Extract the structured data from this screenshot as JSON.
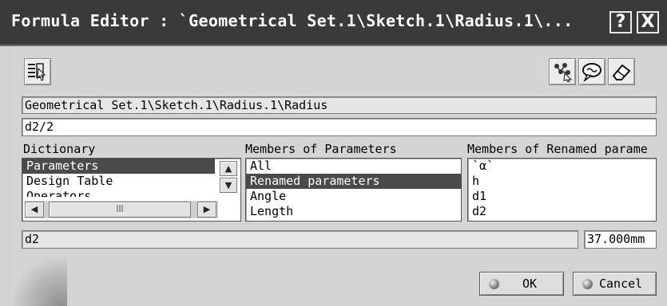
{
  "window": {
    "title": "Formula Editor : `Geometrical Set.1\\Sketch.1\\Radius.1\\...",
    "help_label": "?",
    "close_label": "X"
  },
  "toolbar": {
    "left_icon": "parameter-list-icon",
    "right_icons": [
      "formula-tree-icon",
      "comment-icon",
      "eraser-icon"
    ]
  },
  "path_field": "Geometrical Set.1\\Sketch.1\\Radius.1\\Radius",
  "formula_input": "d2/2",
  "dictionary": {
    "header": "Dictionary",
    "items": [
      "Parameters",
      "Design Table",
      "Operators"
    ],
    "selected": 0
  },
  "members": {
    "header": "Members of Parameters",
    "items": [
      "All",
      "Renamed parameters",
      "Angle",
      "Length"
    ],
    "selected": 1
  },
  "renamed": {
    "header": "Members of Renamed parame",
    "items": [
      "`α`",
      "h",
      "d1",
      "d2"
    ]
  },
  "selection_field": "d2",
  "value_field": "37.000mm",
  "buttons": {
    "ok": "OK",
    "cancel": "Cancel"
  }
}
